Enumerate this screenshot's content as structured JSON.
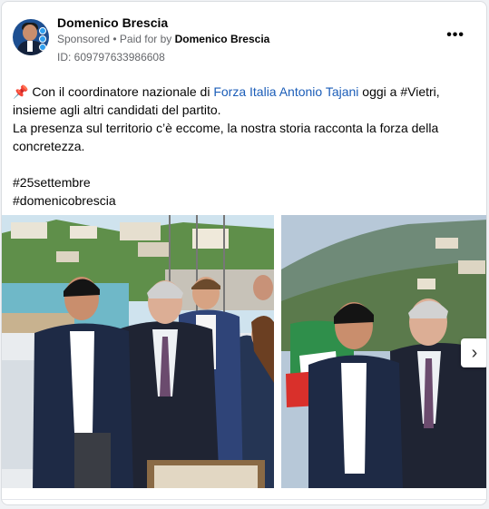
{
  "post": {
    "author": "Domenico Brescia",
    "sponsored": "Sponsored",
    "paid_prefix": " • Paid for by ",
    "paid_by": "Domenico Brescia",
    "ad_id": "ID: 609797633986608",
    "more_icon": "more-horizontal-icon"
  },
  "body": {
    "pin_icon": "📌",
    "line1_a": " Con il coordinatore nazionale di ",
    "line1_link": "Forza Italia Antonio Tajani",
    "line1_b": " oggi a #Vietri,",
    "line2": "insieme agli altri candidati del partito.",
    "line3": "La presenza sul territorio c’è eccome, la nostra storia racconta la forza della concretezza.",
    "hashtag1": "#25settembre",
    "hashtag2": "#domenicobrescia"
  },
  "carousel": {
    "next_icon": "chevron-right-icon"
  },
  "colors": {
    "link": "#1b5db8",
    "meta": "#65676b",
    "brand": "#1d4f91"
  }
}
